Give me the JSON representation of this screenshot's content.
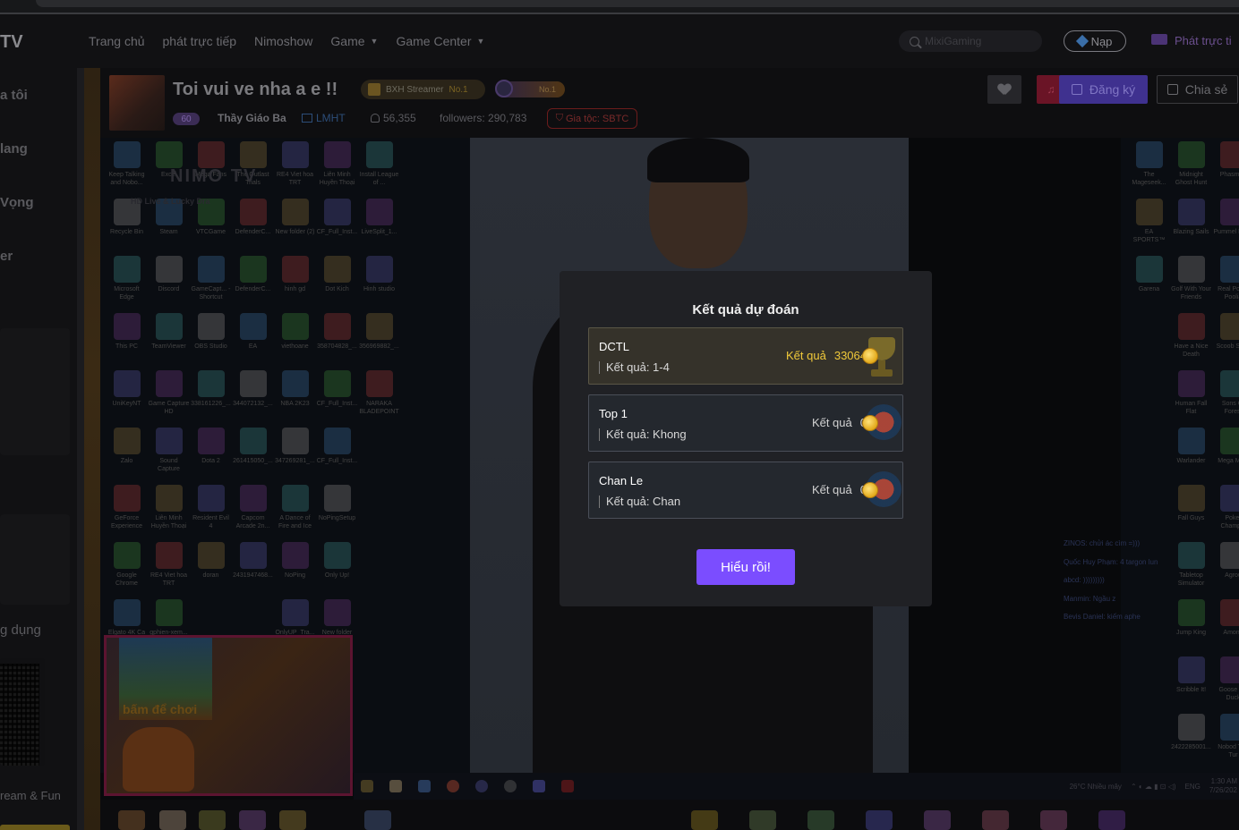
{
  "nav": {
    "logo": "TV",
    "items": [
      "Trang chủ",
      "phát trực tiếp",
      "Nimoshow",
      "Game",
      "Game Center"
    ],
    "search_placeholder": "MixiGaming",
    "nap_label": "Nạp",
    "go_live_label": "Phát trực ti"
  },
  "sidebar": {
    "items": [
      "a tôi",
      "lang",
      "Vọng",
      "er"
    ],
    "app_label": "g dụng",
    "footer": "ream & Fun"
  },
  "stream": {
    "title": "Toi vui ve nha a e !!",
    "bxh_label": "BXH Streamer",
    "bxh_rank": "No.1",
    "badge2_rank": "No.1",
    "level": "60",
    "streamer_name": "Thầy Giáo Ba",
    "game": "LMHT",
    "viewers": "56,355",
    "followers": "followers: 290,783",
    "clan": "Gia tộc: SBTC",
    "subscribe_label": "Đăng ký",
    "share_label": "Chia sẻ"
  },
  "video": {
    "watermark": "NIMO TV",
    "watermark_sub": "HD Live & Lucky Dra",
    "overlay_text": "bấm để chơi",
    "left_icons": [
      "Keep Talking and Nobo...",
      "Excel",
      "Mega Fans",
      "The Outlast Trials",
      "RE4 Viet hoa TRT",
      "Liên Minh Huyền Thoại",
      "Install League of ...",
      "Recycle Bin",
      "Steam",
      "VTCGame",
      "DefenderC...",
      "New folder (2)",
      "CF_Full_Inst...",
      "LiveSplit_1...",
      "Microsoft Edge",
      "Discord",
      "GameCapt... - Shortcut",
      "DefenderC...",
      "hinh gd",
      "Dot Kich",
      "Hinh studio",
      "This PC",
      "TeamViewer",
      "OBS Studio",
      "EA",
      "viethoane",
      "358704828_...",
      "356969882_...",
      "UniKeyNT",
      "Game Capture HD",
      "338161226_...",
      "344072132_...",
      "NBA 2K23",
      "CF_Full_Inst...",
      "NARAKA BLADEPOINT",
      "Zalo",
      "Sound Capture",
      "Dota 2",
      "261415050_...",
      "347269281_...",
      "CF_Full_Inst...",
      "",
      "GeForce Experience",
      "Liên Minh Huyền Thoại",
      "Resident Evil 4",
      "Capcom Arcade 2n...",
      "A Dance of Fire and Ice",
      "NoPingSetup",
      "",
      "Google Chrome",
      "RE4 Viet hoa TRT",
      "doran",
      "2431947468...",
      "NoPing",
      "Only Up!",
      "",
      "Elgato 4K Ca",
      "gphien-xem...",
      "",
      "",
      "OnlyUP_Tra...",
      "New folder",
      ""
    ],
    "right_icons": [
      "The Mageseek...",
      "Midnight Ghost Hunt",
      "Phasmop",
      "EA SPORTS™ FIFA 23",
      "Blazing Sails",
      "Pummel Party",
      "Garena",
      "Golf With Your Friends",
      "Real Pool - Poolia",
      "",
      "Have a Nice Death",
      "Scoob Splat",
      "",
      "Human Fall Flat",
      "Sons Of Forest",
      "",
      "Warlander",
      "Mega M 11",
      "",
      "Fall Guys",
      "Poker Champio",
      "",
      "Tabletop Simulator",
      "Agrou",
      "",
      "Jump King",
      "Among",
      "",
      "Scribble It!",
      "Goose Go Duck",
      "",
      "2422285001...",
      "Nobod The Tur"
    ],
    "chat_lines": [
      "ZINOS: chửi ác cìm =)))",
      "Quốc Huy Phạm: 4 targon lun",
      "abcd: )))))))))",
      "Manmin: Ngầu z",
      "Bevis Daniel: kiếm aphe"
    ],
    "tray_weather": "26°C  Nhiều mây",
    "tray_lang": "ENG",
    "tray_time": "1:30 AM",
    "tray_date": "7/26/202"
  },
  "modal": {
    "title": "Kết quả dự đoán",
    "predictions": [
      {
        "name": "DCTL",
        "result": "Kết quả: 1-4",
        "reward_label": "Kết quả",
        "reward_value": "33064",
        "winner": true
      },
      {
        "name": "Top 1",
        "result": "Kết quả: Khong",
        "reward_label": "Kết quả",
        "reward_value": "0",
        "winner": false
      },
      {
        "name": "Chan Le",
        "result": "Kết quả: Chan",
        "reward_label": "Kết quả",
        "reward_value": "0",
        "winner": false
      }
    ],
    "ok_label": "Hiểu rồi!"
  },
  "colors": {
    "accent": "#7b4dff",
    "win_gold": "#f0c93a",
    "modal_bg": "#202125"
  }
}
